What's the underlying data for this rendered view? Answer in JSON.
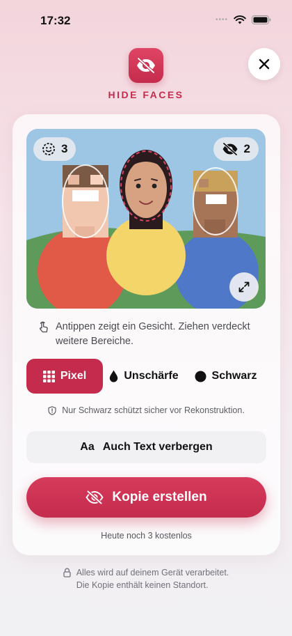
{
  "status": {
    "time": "17:32"
  },
  "app": {
    "title": "HIDE FACES"
  },
  "photo": {
    "faces_count": "3",
    "hidden_count": "2",
    "colors": {
      "sky": "#9cc6e4",
      "grass": "#5e9a5a",
      "shirt_left": "#e05a47",
      "shirt_mid": "#f4d56a",
      "shirt_right": "#4f78c9"
    }
  },
  "hint": {
    "text": "Antippen zeigt ein Gesicht. Ziehen verdeckt weitere Bereiche."
  },
  "modes": [
    {
      "label": "Pixel",
      "icon": "pixel-grid-icon",
      "selected": true
    },
    {
      "label": "Unschärfe",
      "icon": "drop-icon",
      "selected": false
    },
    {
      "label": "Schwarz",
      "icon": "circle-icon",
      "selected": false
    }
  ],
  "protect_note": "Nur Schwarz schützt sicher vor Rekonstruktion.",
  "text_toggle": {
    "prefix": "Aa",
    "label": "Auch Text verbergen"
  },
  "primary": {
    "label": "Kopie erstellen"
  },
  "quota": "Heute noch 3 kostenlos",
  "footer": {
    "line1": "Alles wird auf deinem Gerät verarbeitet.",
    "line2": "Die Kopie enthält keinen Standort."
  },
  "accent": "#c42b4c"
}
